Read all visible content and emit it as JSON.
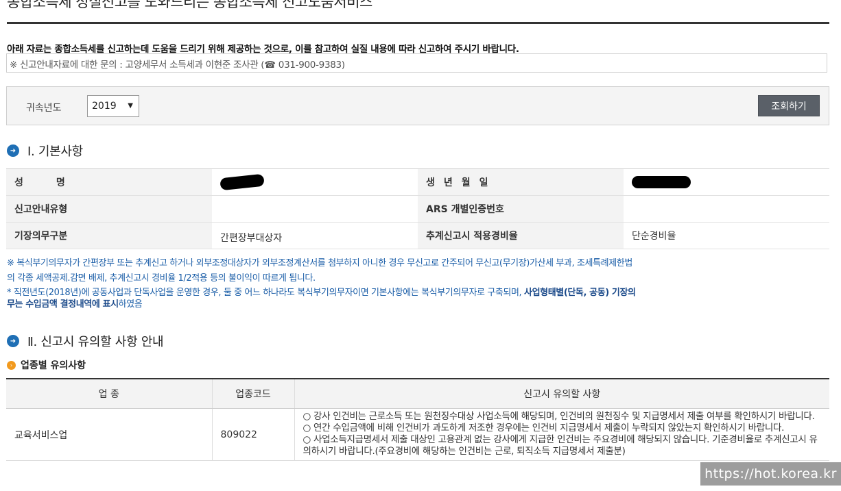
{
  "page": {
    "title": "종합소득세 성실신고를 도와드리는 종합소득세 신고도움서비스",
    "notice": "아래 자료는 종합소득세를 신고하는데 도움을 드리기 위해 제공하는 것으로, 이를 참고하여 실질 내용에 따라 신고하여 주시기 바랍니다.",
    "inquiry": "※ 신고안내자료에 대한 문의 : 고양세무서 소득세과 이현준 조사관 (☎ 031-900-9383)"
  },
  "search": {
    "year_label": "귀속년도",
    "year_value": "2019",
    "search_button": "조회하기"
  },
  "section1": {
    "title": "Ⅰ. 기본사항",
    "rows": [
      {
        "label1": "성명",
        "value1": "",
        "label2": "생년월일",
        "value2": ""
      },
      {
        "label1": "신고안내유형",
        "value1": "",
        "label2": "ARS 개별인증번호",
        "value2": ""
      },
      {
        "label1": "기장의무구분",
        "value1": "간편장부대상자",
        "label2": "추계신고시 적용경비율",
        "value2": "단순경비율"
      }
    ],
    "note1_line1": "※ 복식부기의무자가 간편장부 또는 추계신고 하거나 외부조정대상자가 외부조정계산서를 첨부하지 아니한 경우 무신고로 간주되어 무신고(무기장)가산세 부과, 조세특례제한법",
    "note1_line2": "의 각종 세액공제.감면 배제, 추계신고시 경비율 1/2적용 등의 불이익이 따르게 됩니다.",
    "note2_line1_a": "* 직전년도(2018년)에 공동사업과 단독사업을 운영한 경우, 둘 중 어느 하나라도 복식부기의무자이면 기본사항에는 복식부기의무자로 구축되며, ",
    "note2_line1_b": "사업형태별(단독, 공동) 기장의",
    "note2_line2_a": "무는 수입금액 결정내역에 표시",
    "note2_line2_b": "하였음"
  },
  "section2": {
    "title": "Ⅱ. 신고시 유의할 사항 안내",
    "subtitle": "업종별 유의사항",
    "table_headers": [
      "업 종",
      "업종코드",
      "신고시 유의할 사항"
    ],
    "rows": [
      {
        "industry": "교육서비스업",
        "code": "809022",
        "notes": [
          "○ 강사 인건비는 근로소득 또는 원천징수대상 사업소득에 해당되며, 인건비의 원천징수 및 지급명세서 제출 여부를 확인하시기 바랍니다.",
          "○ 연간 수입금액에 비해 인건비가 과도하게 저조한 경우에는 인건비 지급명세서 제출이 누락되지 않았는지 확인하시기 바랍니다.",
          "○ 사업소득지급명세서 제출 대상인 고용관계 없는 강사에게 지급한 인건비는 주요경비에 해당되지 않습니다. 기준경비율로 추계신고시 유의하시기 바랍니다.(주요경비에 해당하는 인건비는 근로, 퇴직소득 지급명세서 제출분)"
        ]
      }
    ]
  },
  "watermark": "https://hot.korea.kr",
  "colors": {
    "accent_blue": "#1f6fb5",
    "note_blue": "#1b5ea8",
    "button_gray": "#5a6068",
    "orange": "#f29a1e"
  }
}
